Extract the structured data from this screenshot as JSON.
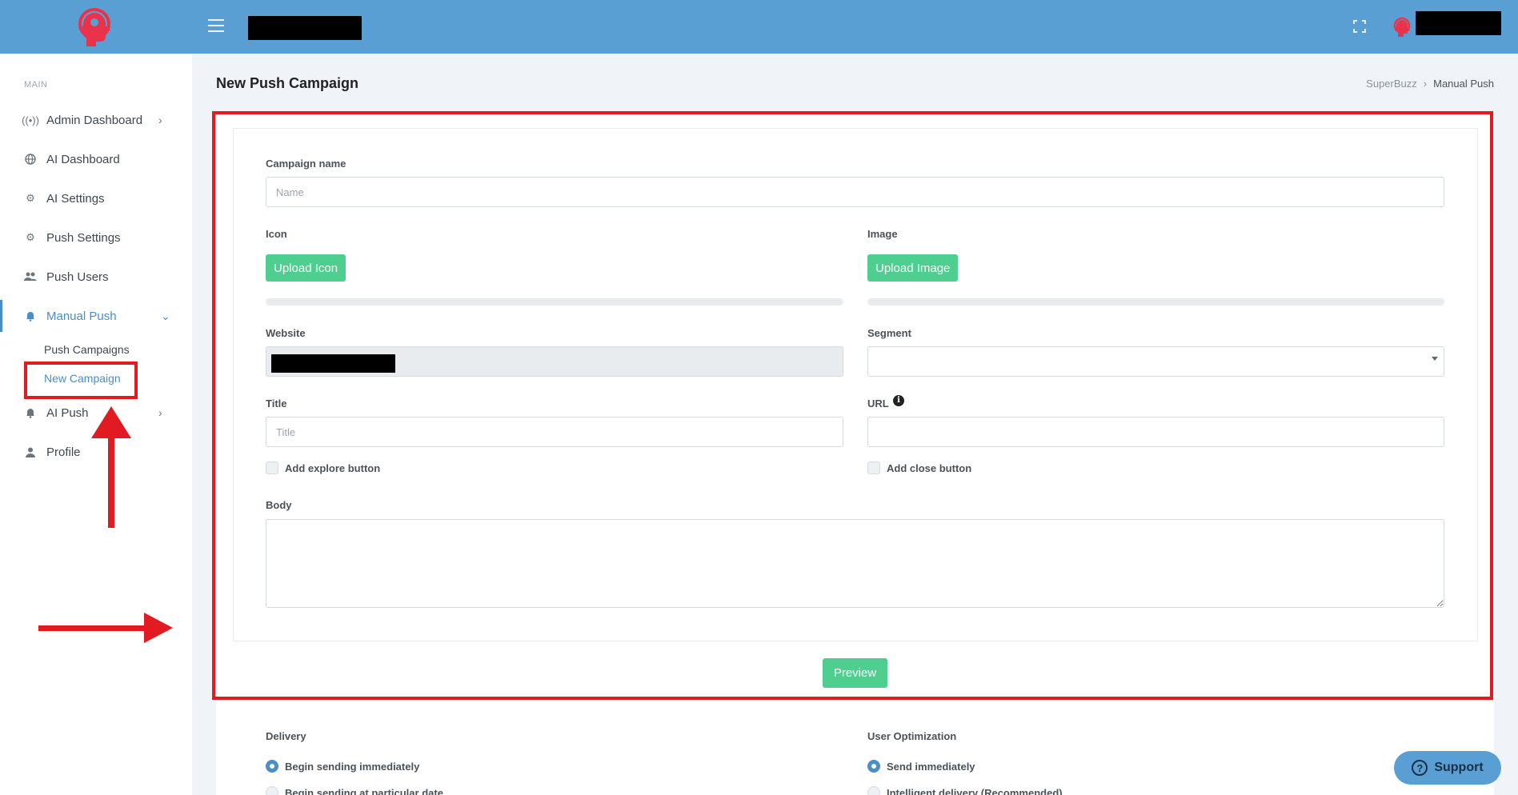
{
  "header": {
    "brand_redacted": "",
    "user_redacted": ""
  },
  "sidebar": {
    "section_label": "MAIN",
    "items": [
      {
        "label": "Admin Dashboard",
        "icon": "broadcast-icon"
      },
      {
        "label": "AI Dashboard",
        "icon": "globe-icon"
      },
      {
        "label": "AI Settings",
        "icon": "gear-icon"
      },
      {
        "label": "Push Settings",
        "icon": "gear-icon"
      },
      {
        "label": "Push Users",
        "icon": "users-icon"
      },
      {
        "label": "Manual Push",
        "icon": "bell-ring-icon"
      },
      {
        "label": "AI Push",
        "icon": "bell-icon"
      },
      {
        "label": "Profile",
        "icon": "user-icon"
      }
    ],
    "manual_push_sub": [
      "Push Campaigns",
      "New Campaign"
    ]
  },
  "page": {
    "title": "New Push Campaign",
    "breadcrumb": [
      "SuperBuzz",
      "Manual Push"
    ]
  },
  "form": {
    "campaign_name_label": "Campaign name",
    "campaign_name_placeholder": "Name",
    "icon_label": "Icon",
    "upload_icon_label": "Upload Icon",
    "image_label": "Image",
    "upload_image_label": "Upload Image",
    "website_label": "Website",
    "segment_label": "Segment",
    "title_label": "Title",
    "title_placeholder": "Title",
    "url_label": "URL",
    "explore_label": "Add explore button",
    "close_label": "Add close button",
    "body_label": "Body",
    "preview_label": "Preview"
  },
  "delivery": {
    "label": "Delivery",
    "options": [
      "Begin sending immediately",
      "Begin sending at particular date"
    ]
  },
  "optimization": {
    "label": "User Optimization",
    "options": [
      "Send immediately",
      "Intelligent delivery (Recommended)"
    ]
  },
  "support": {
    "label": "Support"
  },
  "colors": {
    "topbar": "#5a9fd4",
    "accent": "#4a8ec9",
    "button_green": "#4fcf8f",
    "annotation_red": "#e21b23"
  }
}
